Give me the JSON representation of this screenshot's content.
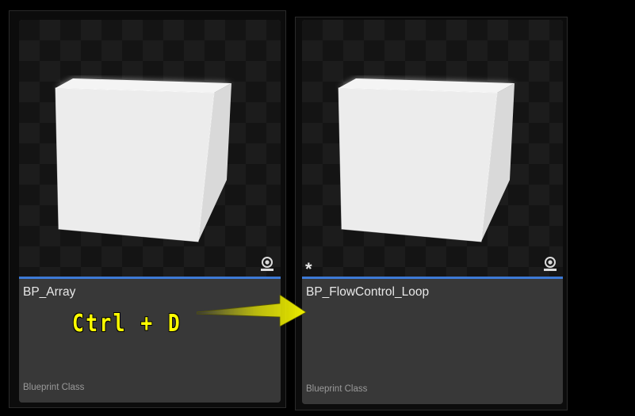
{
  "assets": [
    {
      "name": "BP_Array",
      "type": "Blueprint Class",
      "thumbnail_icon": "cube-thumbnail",
      "corner_icon": "camera-icon",
      "modified_marker": ""
    },
    {
      "name": "BP_FlowControl_Loop",
      "type": "Blueprint Class",
      "thumbnail_icon": "cube-thumbnail",
      "corner_icon": "camera-icon",
      "modified_marker": "*"
    }
  ],
  "annotation": {
    "shortcut": "Ctrl + D",
    "arrow_color": "#ffff00"
  },
  "colors": {
    "accent": "#3d7ad6",
    "tile_background": "#383838",
    "label_text": "#e8e8e8",
    "type_text": "#9a9a9a"
  }
}
